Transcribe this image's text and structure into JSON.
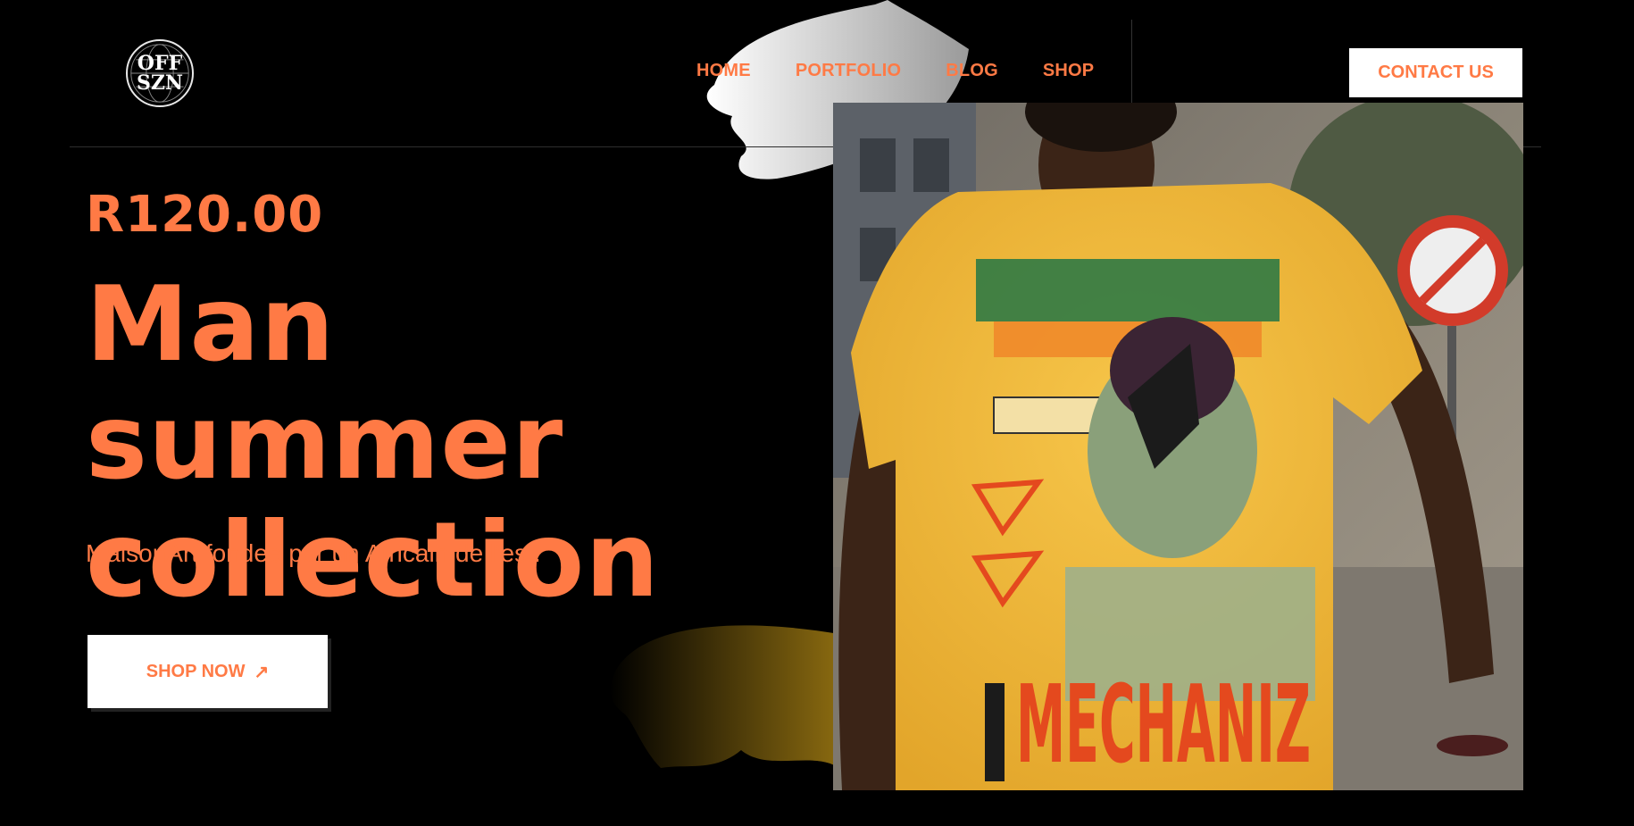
{
  "brand": {
    "logo_line1": "OFF",
    "logo_line2": "SZN",
    "logo_icon": "globe-icon"
  },
  "nav": {
    "items": [
      "HOME",
      "PORTFOLIO",
      "BLOG",
      "SHOP"
    ]
  },
  "header": {
    "contact_label": "CONTACT US"
  },
  "hero": {
    "price": "R120.00",
    "title_line1": "Man summer",
    "title_line2": "collection",
    "tagline": "MaisonArt fondee par un Africain de l'est.",
    "cta_label": "SHOP NOW",
    "cta_icon": "arrow-up-right-icon",
    "image_alt": "man-in-yellow-tshirt-photo",
    "shirt_text": "MECHANIZ"
  },
  "colors": {
    "accent": "#ff7a45",
    "background": "#000000",
    "button_bg": "#ffffff"
  }
}
